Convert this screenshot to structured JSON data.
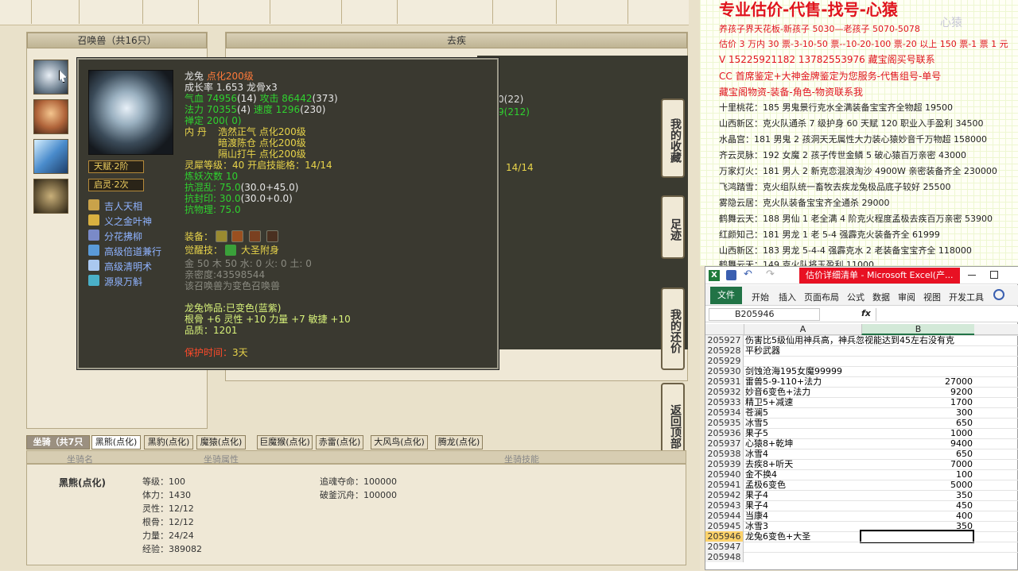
{
  "pet_panel": {
    "title": "召唤兽（共16只）"
  },
  "right_panel": {
    "title": "去疾",
    "partial_values": [
      "0(22)",
      "9(212)",
      "14/14"
    ]
  },
  "tooltip": {
    "pet_name": "龙兔",
    "pet_enhance": "点化200级",
    "growth": "成长率 1.653 龙骨x3",
    "hp_label": "气血 74956",
    "hp_extra": "(14)",
    "attack_label": "攻击 86442",
    "attack_extra": "(373)",
    "mp_label": "法力 70355",
    "mp_extra": "(4)",
    "speed_label": "速度 1296",
    "speed_extra": "(230)",
    "zen": "禅定 200( 0)",
    "dan_label": "内 丹",
    "dan1": "浩然正气 点化200级",
    "dan2": "暗渡陈仓 点化200级",
    "dan3": "隔山打牛 点化200级",
    "spirit_level": "灵犀等级：40 开启技能格：14/14",
    "refine": "炼妖次数 10",
    "resist1": "抗混乱: 75.0",
    "resist1_extra": "(30.0+45.0)",
    "resist2": "抗封印: 30.0",
    "resist2_extra": "(30.0+0.0)",
    "resist3": "抗物理: 75.0",
    "talent_badge": "天赋·2阶",
    "spirit_badge": "启灵·2次",
    "skills": [
      "吉人天相",
      "义之金叶神",
      "分花拂柳",
      "高级倍道兼行",
      "高级清明术",
      "源泉万斛"
    ],
    "equip_label": "装备：",
    "awaken_label": "觉醒技：",
    "awaken_skill": "大圣附身",
    "elements": "金 50 木 50 水: 0 火: 0 土: 0",
    "intimacy": "亲密度:43598544",
    "variant_note": "该召唤兽为变色召唤兽",
    "ornament": "龙兔饰品:已变色(蓝紫)",
    "ornament_stats": "根骨 +6 灵性 +10 力量 +7 敏捷 +10",
    "quality": "品质：1201",
    "protect_label": "保护时间：",
    "protect_value": "3天"
  },
  "side_tabs": [
    "我的收藏",
    "足迹",
    "我的还价",
    "返回顶部"
  ],
  "mount": {
    "count_tab": "坐骑（共7只",
    "tabs": [
      "黑熊(点化)",
      "黑豹(点化)",
      "魔猿(点化)",
      "巨魔猴(点化)",
      "赤雷(点化)",
      "大风鸟(点化)",
      "腾龙(点化)"
    ],
    "headers": [
      "坐骑名",
      "坐骑属性",
      "坐骑技能"
    ],
    "name": "黑熊(点化)",
    "attrs": [
      "等级：100",
      "体力：1430",
      "灵性：12/12",
      "根骨：12/12",
      "力量：24/24",
      "经验：389082"
    ],
    "skills": [
      "追魂夺命：100000",
      "破釜沉舟：100000"
    ]
  },
  "ad": {
    "title": "专业估价-代售-找号-心猿",
    "lines": [
      "养孩子界天花板-新孩子 5030—老孩子 5070-5078",
      "估价 3 万内 30 票-3-10-50 票--10-20-100 票-20 以上 150 票-1 票 1 元",
      "V 15225921182      13782553976    藏宝阁买号联系",
      "CC 首席鉴定+大神金牌鉴定为您服务-代售组号-单号",
      "藏宝阁物资-装备-角色-物资联系我",
      "十里桃花：185 男鬼景行克水全满装备宝宝齐全物超 19500",
      "山西新区：克火队通杀 7 级护身 60 天赋 120 职业入手盈利 34500",
      "水晶宫：181 男鬼 2 孩洞天无属性大力装心猿妙音千万物超 158000",
      "齐云灵脉：192 女魔 2 孩子传世金鳞 5 破心猿百万亲密 43000",
      "万家灯火：181 男人 2 新克恋混浪淘沙 4900W 亲密装备齐全 230000",
      "飞鸿踏雪：克火组队统一畜牧去疾龙兔极品底子较好 25500",
      "雾隐云居：克火队装备宝宝齐全通杀 29000",
      "鹤舞云天：188 男仙 1 老全满 4 阶克火程度孟极去疾百万亲密 53900",
      "红颜知己：181 男龙 1 老 5-4 强霹克火装备齐全 61999",
      "山西新区：183 男龙 5-4-4 强霹克水 2 老装备宝宝齐全 118000",
      "鹤舞云天：149 克火队将玉盈利 11000"
    ],
    "watermark": "心猿"
  },
  "excel": {
    "window_title": "估价详细清单 - Microsoft Excel(产...",
    "menu": [
      "文件",
      "开始",
      "插入",
      "页面布局",
      "公式",
      "数据",
      "审阅",
      "视图",
      "开发工具"
    ],
    "name_box": "B205946",
    "fx": "fx",
    "col_a": "A",
    "col_b": "B",
    "rows": [
      {
        "n": "205927",
        "a": "伤害比5级仙用神兵高，神兵忽视能达到45左右没有克",
        "b": ""
      },
      {
        "n": "205928",
        "a": "平秒武器",
        "b": ""
      },
      {
        "n": "205929",
        "a": "",
        "b": ""
      },
      {
        "n": "205930",
        "a": "剑蚀沧海195女魔99999",
        "b": ""
      },
      {
        "n": "205931",
        "a": "雷兽5-9-110+法力",
        "b": "27000"
      },
      {
        "n": "205932",
        "a": "妙音6变色+法力",
        "b": "9200"
      },
      {
        "n": "205933",
        "a": "精卫5+减速",
        "b": "1700"
      },
      {
        "n": "205934",
        "a": "苍澜5",
        "b": "300"
      },
      {
        "n": "205935",
        "a": "冰雪5",
        "b": "650"
      },
      {
        "n": "205936",
        "a": "果子5",
        "b": "1000"
      },
      {
        "n": "205937",
        "a": "心猿8+乾坤",
        "b": "9400"
      },
      {
        "n": "205938",
        "a": "冰雪4",
        "b": "650"
      },
      {
        "n": "205939",
        "a": "去疾8+听天",
        "b": "7000"
      },
      {
        "n": "205940",
        "a": "金不换4",
        "b": "100"
      },
      {
        "n": "205941",
        "a": "孟极6变色",
        "b": "5000"
      },
      {
        "n": "205942",
        "a": "果子4",
        "b": "350"
      },
      {
        "n": "205943",
        "a": "果子4",
        "b": "450"
      },
      {
        "n": "205944",
        "a": "当康4",
        "b": "400"
      },
      {
        "n": "205945",
        "a": "冰雪3",
        "b": "350"
      },
      {
        "n": "205946",
        "a": "龙兔6变色+大圣",
        "b": ""
      },
      {
        "n": "205947",
        "a": "",
        "b": ""
      },
      {
        "n": "205948",
        "a": "",
        "b": ""
      }
    ]
  }
}
